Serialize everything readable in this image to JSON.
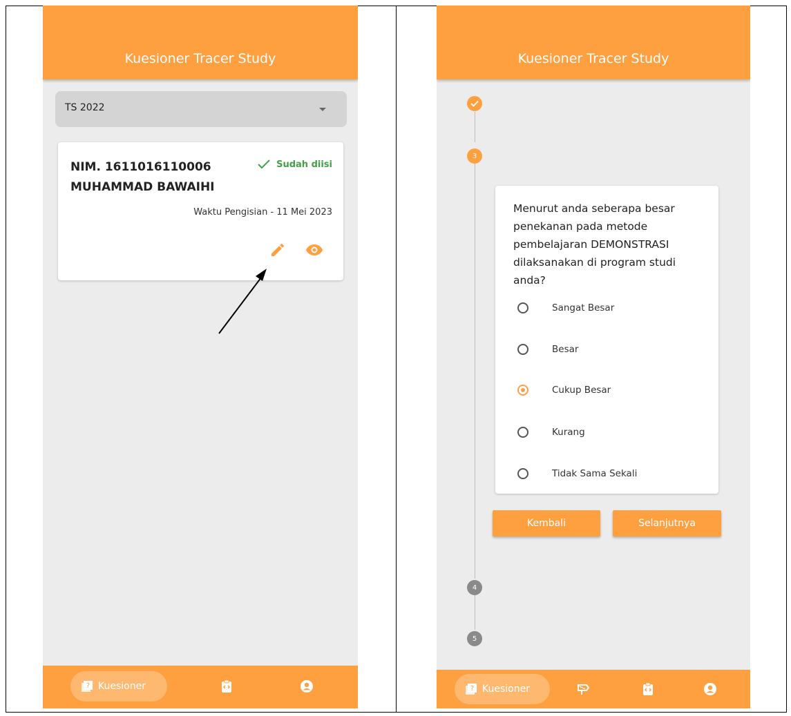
{
  "left": {
    "title": "Kuesioner Tracer Study",
    "dropdown_value": "TS 2022",
    "card": {
      "nim": "NIM. 1611016110006",
      "name": "MUHAMMAD BAWAIHI",
      "status": "Sudah diisi",
      "waktu": "Waktu Pengisian - 11 Mei 2023"
    },
    "nav": {
      "kuesioner": "Kuesioner"
    }
  },
  "right": {
    "title": "Kuesioner Tracer Study",
    "steps": {
      "current": "3",
      "next1": "4",
      "next2": "5"
    },
    "question": "Menurut anda seberapa besar penekanan pada metode pembelajaran DEMONSTRASI dilaksanakan di program studi anda?",
    "options": [
      "Sangat Besar",
      "Besar",
      "Cukup Besar",
      "Kurang",
      "Tidak Sama Sekali"
    ],
    "selected_option": "Cukup Besar",
    "buttons": {
      "back": "Kembali",
      "next": "Selanjutnya"
    },
    "nav": {
      "kuesioner": "Kuesioner"
    }
  },
  "colors": {
    "primary": "#FFA040",
    "success": "#43a047",
    "background": "#ececec"
  }
}
